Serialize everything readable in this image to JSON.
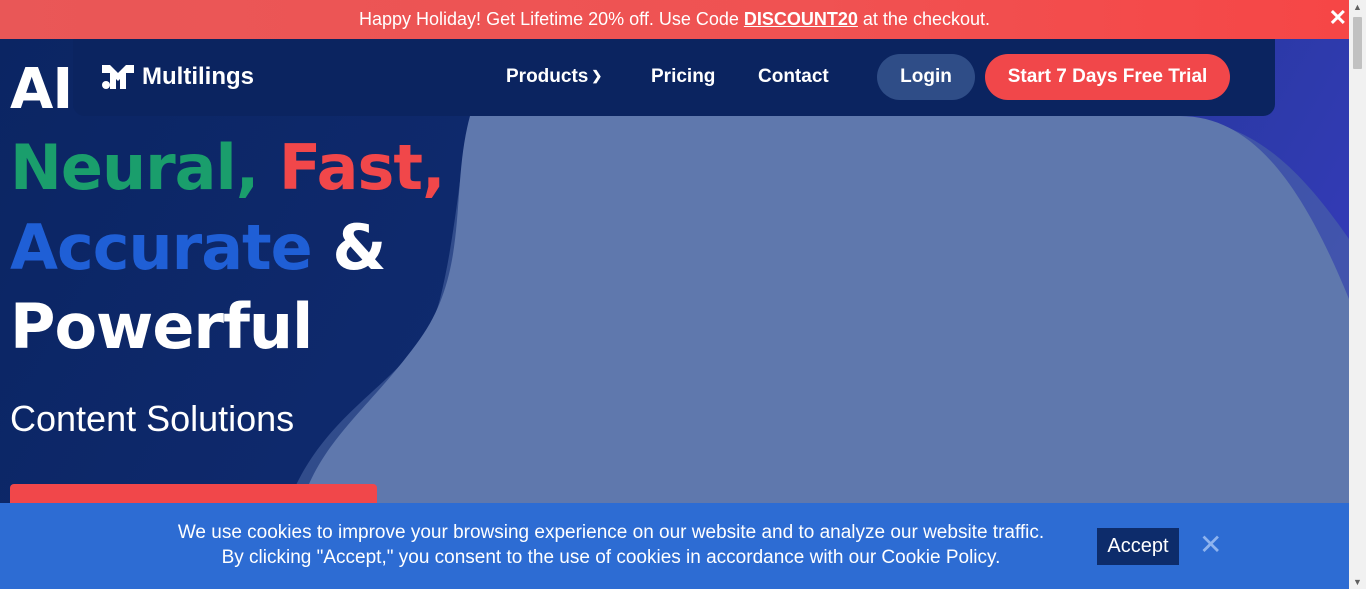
{
  "promo": {
    "text_before": "Happy Holiday! Get Lifetime 20% off. Use Code",
    "code": "DISCOUNT20",
    "text_after": "at the checkout.",
    "close": "✕"
  },
  "nav": {
    "logo_text": "Multilings",
    "products": "Products",
    "pricing": "Pricing",
    "contact": "Contact",
    "login": "Login",
    "trial": "Start 7 Days Free Trial"
  },
  "hero": {
    "line1": "AI",
    "neural": "Neural,",
    "fast": "Fast,",
    "accurate": "Accurate",
    "amp": "&",
    "powerful": "Powerful",
    "subhead": "Content Solutions"
  },
  "cookie": {
    "line1": "We use cookies to improve your browsing experience on our website and to analyze our website traffic.",
    "line2": "By clicking \"Accept,\" you consent to the use of cookies in accordance with our Cookie Policy.",
    "accept": "Accept",
    "close": "✕"
  },
  "colors": {
    "brand_red": "#f1474a",
    "brand_green": "#1a9e6c",
    "brand_blue": "#1f5fd6",
    "navy": "#0b2460",
    "cookie_bg": "#2d6cd3"
  }
}
